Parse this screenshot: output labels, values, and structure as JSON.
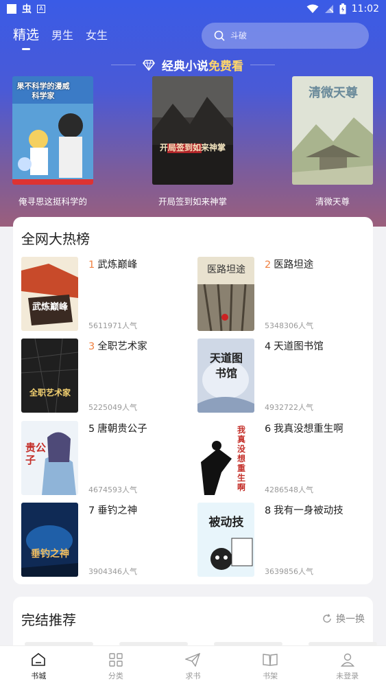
{
  "status": {
    "time": "11:02",
    "app_glyph": "虫",
    "small_badge": "A"
  },
  "tabs": [
    {
      "label": "精选"
    },
    {
      "label": "男生"
    },
    {
      "label": "女生"
    }
  ],
  "search": {
    "placeholder": "斗破"
  },
  "banner": {
    "text": "经典小说",
    "highlight": "免费看"
  },
  "featured": [
    {
      "title": "俺寻思这挺科学的",
      "cover_text": "果不科学的漫威科学家"
    },
    {
      "title": "开局签到如来神掌",
      "cover_text": "开局签到如来神掌"
    },
    {
      "title": "清微天尊",
      "cover_text": "清微天尊"
    }
  ],
  "hot": {
    "title": "全网大热榜",
    "books": [
      {
        "rank": "1",
        "name": "武炼巅峰",
        "popularity": "5611971人气",
        "cover_text": "武炼巅峰"
      },
      {
        "rank": "2",
        "name": "医路坦途",
        "popularity": "5348306人气",
        "cover_text": "医路坦途"
      },
      {
        "rank": "3",
        "name": "全职艺术家",
        "popularity": "5225049人气",
        "cover_text": "全职艺术家"
      },
      {
        "rank": "4",
        "name": "天道图书馆",
        "popularity": "4932722人气",
        "cover_text": "天道图书馆"
      },
      {
        "rank": "5",
        "name": "唐朝贵公子",
        "popularity": "4674593人气",
        "cover_text": "贵公子"
      },
      {
        "rank": "6",
        "name": "我真没想重生啊",
        "popularity": "4286548人气",
        "cover_text": "我真没想重生啊"
      },
      {
        "rank": "7",
        "name": "垂钓之神",
        "popularity": "3904346人气",
        "cover_text": "垂钓之神"
      },
      {
        "rank": "8",
        "name": "我有一身被动技",
        "popularity": "3639856人气",
        "cover_text": "被动技"
      }
    ]
  },
  "finished": {
    "title": "完结推荐",
    "refresh_label": "换一换"
  },
  "nav": [
    {
      "label": "书城",
      "icon": "home-icon"
    },
    {
      "label": "分类",
      "icon": "grid-icon"
    },
    {
      "label": "求书",
      "icon": "paper-plane-icon"
    },
    {
      "label": "书架",
      "icon": "book-icon"
    },
    {
      "label": "未登录",
      "icon": "user-icon"
    }
  ],
  "colors": {
    "accent_rank": "#f08040",
    "banner_highlight": "#ffd66b",
    "gradient_top": "#3a5be6",
    "gradient_bottom": "#9b5f7c"
  }
}
